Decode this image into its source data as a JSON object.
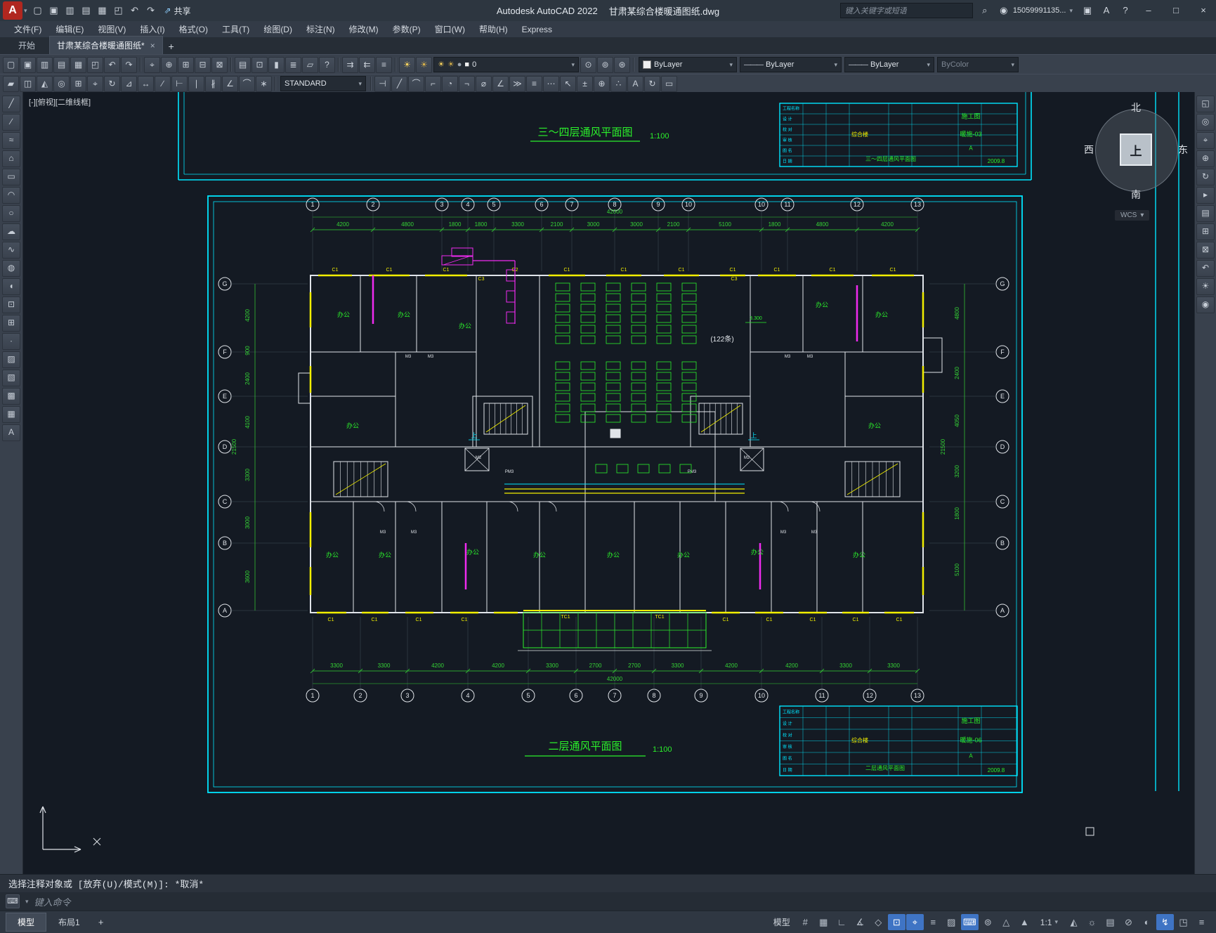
{
  "titlebar": {
    "logo_letter": "A",
    "qat_icons": [
      {
        "name": "new-file-icon",
        "glyph": "▢"
      },
      {
        "name": "open-file-icon",
        "glyph": "▣"
      },
      {
        "name": "save-icon",
        "glyph": "▥"
      },
      {
        "name": "save-as-icon",
        "glyph": "▤"
      },
      {
        "name": "plot-icon",
        "glyph": "▦"
      },
      {
        "name": "plot-preview-icon",
        "glyph": "◰"
      },
      {
        "name": "undo-icon",
        "glyph": "↶"
      },
      {
        "name": "redo-icon",
        "glyph": "↷"
      }
    ],
    "share_icon_glyph": "⇗",
    "share_label": "共享",
    "app_title": "Autodesk AutoCAD 2022",
    "doc_title": "甘肃某综合楼暖通图纸.dwg",
    "search_placeholder": "键入关键字或短语",
    "search_icon_glyph": "⌕",
    "account_id": "15059991135...",
    "cart_icon_glyph": "▣",
    "apps_icon_glyph": "A",
    "help_icon_glyph": "?",
    "minimize_glyph": "–",
    "maximize_glyph": "□",
    "close_glyph": "×",
    "caret_glyph": "▾"
  },
  "menubar": {
    "items": [
      "文件(F)",
      "编辑(E)",
      "视图(V)",
      "插入(I)",
      "格式(O)",
      "工具(T)",
      "绘图(D)",
      "标注(N)",
      "修改(M)",
      "参数(P)",
      "窗口(W)",
      "帮助(H)",
      "Express"
    ]
  },
  "filetabs": {
    "start_label": "开始",
    "doc_label": "甘肃某综合楼暖通图纸*",
    "close_glyph": "×",
    "new_tab_glyph": "+"
  },
  "toolbar1": {
    "file_icons": [
      {
        "name": "new-file-icon",
        "glyph": "▢"
      },
      {
        "name": "open-file-icon",
        "glyph": "▣"
      },
      {
        "name": "save-icon",
        "glyph": "▥"
      },
      {
        "name": "save-as-icon",
        "glyph": "▤"
      },
      {
        "name": "plot-icon",
        "glyph": "▦"
      },
      {
        "name": "plot-preview-icon",
        "glyph": "◰"
      },
      {
        "name": "undo-icon",
        "glyph": "↶"
      },
      {
        "name": "redo-icon",
        "glyph": "↷"
      }
    ],
    "view_icons": [
      {
        "name": "pan-icon",
        "glyph": "⌖"
      },
      {
        "name": "zoom-realtime-icon",
        "glyph": "⊕"
      },
      {
        "name": "zoom-window-icon",
        "glyph": "⊞"
      },
      {
        "name": "zoom-previous-icon",
        "glyph": "⊟"
      },
      {
        "name": "zoom-extents-icon",
        "glyph": "⊠"
      }
    ],
    "palette_icons": [
      {
        "name": "properties-palette-icon",
        "glyph": "▤"
      },
      {
        "name": "design-center-icon",
        "glyph": "⊡"
      },
      {
        "name": "tool-palettes-icon",
        "glyph": "▮"
      },
      {
        "name": "sheet-set-manager-icon",
        "glyph": "≣"
      },
      {
        "name": "markup-import-icon",
        "glyph": "▱"
      },
      {
        "name": "help-icon",
        "glyph": "?"
      }
    ],
    "layer_tool_icons": [
      {
        "name": "match-properties-icon",
        "glyph": "⇉"
      },
      {
        "name": "layer-previous-icon",
        "glyph": "⇇"
      },
      {
        "name": "layer-properties-icon",
        "glyph": "≡"
      }
    ],
    "layer_bulb_icons": [
      {
        "name": "layer-on-icon",
        "glyph": "☀",
        "color": "#ffd75e"
      },
      {
        "name": "layer-freeze-icon",
        "glyph": "☀",
        "color": "#d8b14a"
      }
    ],
    "layer_combo": {
      "bulb_glyph": "☀",
      "freeze_glyph": "☀",
      "lock_glyph": "●",
      "swatch_glyph": "■",
      "value": "0"
    },
    "post_layer_icons": [
      {
        "name": "make-object-layer-current-icon",
        "glyph": "⊙"
      },
      {
        "name": "layer-walk-icon",
        "glyph": "⊚"
      },
      {
        "name": "layer-isolate-icon",
        "glyph": "⊛"
      }
    ],
    "color_combo": {
      "value": "ByLayer"
    },
    "linetype_combo": {
      "sample": "———",
      "value": "ByLayer"
    },
    "lineweight_combo": {
      "sample": "———",
      "value": "ByLayer"
    },
    "plotstyle_combo": {
      "value": "ByColor"
    },
    "caret_glyph": "▾"
  },
  "toolbar2": {
    "modify_icons": [
      {
        "name": "erase-icon",
        "glyph": "▰"
      },
      {
        "name": "copy-icon",
        "glyph": "◫"
      },
      {
        "name": "mirror-icon",
        "glyph": "◭"
      },
      {
        "name": "offset-icon",
        "glyph": "◎"
      },
      {
        "name": "array-icon",
        "glyph": "⊞"
      },
      {
        "name": "move-icon",
        "glyph": "⌖"
      },
      {
        "name": "rotate-icon",
        "glyph": "↻"
      },
      {
        "name": "scale-icon",
        "glyph": "⊿"
      },
      {
        "name": "stretch-icon",
        "glyph": "↔"
      },
      {
        "name": "trim-icon",
        "glyph": "∕"
      },
      {
        "name": "extend-icon",
        "glyph": "⊢"
      },
      {
        "name": "break-at-point-icon",
        "glyph": "∣"
      },
      {
        "name": "break-icon",
        "glyph": "∦"
      },
      {
        "name": "chamfer-icon",
        "glyph": "∠"
      },
      {
        "name": "fillet-icon",
        "glyph": "⌒"
      },
      {
        "name": "explode-icon",
        "glyph": "∗"
      }
    ],
    "style_combo": {
      "value": "STANDARD"
    },
    "dim_icons": [
      {
        "name": "linear-dim-icon",
        "glyph": "⊣"
      },
      {
        "name": "aligned-dim-icon",
        "glyph": "╱"
      },
      {
        "name": "arc-length-dim-icon",
        "glyph": "⌒"
      },
      {
        "name": "ordinate-dim-icon",
        "glyph": "⌐"
      },
      {
        "name": "radius-dim-icon",
        "glyph": "◔"
      },
      {
        "name": "jogged-dim-icon",
        "glyph": "¬"
      },
      {
        "name": "diameter-dim-icon",
        "glyph": "⌀"
      },
      {
        "name": "angular-dim-icon",
        "glyph": "∠"
      },
      {
        "name": "quick-dim-icon",
        "glyph": "≫"
      },
      {
        "name": "baseline-dim-icon",
        "glyph": "≡"
      },
      {
        "name": "continue-dim-icon",
        "glyph": "⋯"
      },
      {
        "name": "leader-icon",
        "glyph": "↖"
      },
      {
        "name": "tolerance-icon",
        "glyph": "±"
      },
      {
        "name": "center-mark-icon",
        "glyph": "⊕"
      },
      {
        "name": "dim-edit-icon",
        "glyph": "∴"
      },
      {
        "name": "dim-text-edit-icon",
        "glyph": "A"
      },
      {
        "name": "dim-update-icon",
        "glyph": "↻"
      },
      {
        "name": "dim-style-icon",
        "glyph": "▭"
      }
    ],
    "caret_glyph": "▾"
  },
  "left_palette": {
    "icons": [
      {
        "name": "line-tool-icon",
        "glyph": "╱"
      },
      {
        "name": "construction-line-tool-icon",
        "glyph": "∕"
      },
      {
        "name": "polyline-tool-icon",
        "glyph": "≈"
      },
      {
        "name": "polygon-tool-icon",
        "glyph": "⌂"
      },
      {
        "name": "rectangle-tool-icon",
        "glyph": "▭"
      },
      {
        "name": "arc-tool-icon",
        "glyph": "◠"
      },
      {
        "name": "circle-tool-icon",
        "glyph": "○"
      },
      {
        "name": "revision-cloud-tool-icon",
        "glyph": "☁"
      },
      {
        "name": "spline-tool-icon",
        "glyph": "∿"
      },
      {
        "name": "ellipse-tool-icon",
        "glyph": "◍"
      },
      {
        "name": "ellipse-arc-tool-icon",
        "glyph": "◖"
      },
      {
        "name": "insert-block-icon",
        "glyph": "⊡"
      },
      {
        "name": "make-block-icon",
        "glyph": "⊞"
      },
      {
        "name": "point-tool-icon",
        "glyph": "∙"
      },
      {
        "name": "hatch-tool-icon",
        "glyph": "▨"
      },
      {
        "name": "gradient-tool-icon",
        "glyph": "▧"
      },
      {
        "name": "region-tool-icon",
        "glyph": "▩"
      },
      {
        "name": "table-tool-icon",
        "glyph": "▦"
      },
      {
        "name": "mtext-tool-icon",
        "glyph": "A"
      }
    ]
  },
  "right_palette": {
    "icons": [
      {
        "name": "fullscreen-icon",
        "glyph": "◱"
      },
      {
        "name": "navigation-wheel-icon",
        "glyph": "◎"
      },
      {
        "name": "pan-tool-icon",
        "glyph": "⌖"
      },
      {
        "name": "zoom-tool-icon",
        "glyph": "⊕"
      },
      {
        "name": "orbit-tool-icon",
        "glyph": "↻"
      },
      {
        "name": "show-motion-icon",
        "glyph": "▸"
      },
      {
        "name": "named-views-icon",
        "glyph": "▤"
      },
      {
        "name": "zoom-window-tool-icon",
        "glyph": "⊞"
      },
      {
        "name": "zoom-extents-tool-icon",
        "glyph": "⊠"
      },
      {
        "name": "previous-view-icon",
        "glyph": "↶"
      },
      {
        "name": "sun-properties-icon",
        "glyph": "☀"
      },
      {
        "name": "render-icon",
        "glyph": "◉"
      }
    ]
  },
  "canvas": {
    "viewport_label": "[-][俯视][二维线框]",
    "compass": {
      "north": "北",
      "south": "南",
      "west": "西",
      "east": "东",
      "center": "上",
      "wcs": "WCS",
      "caret": "▾"
    },
    "drawing": {
      "sheet_top": {
        "title": "三～四层通风平面图",
        "scale": "1:100",
        "drawing_no": "暖施-03"
      },
      "sheet_bottom": {
        "title": "二层通风平面图",
        "scale": "1:100",
        "drawing_no": "暖施-06"
      },
      "axes_top": {
        "bubbles": [
          "1",
          "2",
          "3",
          "4",
          "5",
          "6",
          "7",
          "8",
          "9",
          "10",
          "10",
          "11",
          "12",
          "13"
        ],
        "dims": [
          "4200",
          "4800",
          "1800",
          "1800",
          "3300",
          "2100",
          "3000",
          "3000",
          "2100",
          "5100",
          "1800",
          "4800",
          "4200"
        ],
        "total": "42000"
      },
      "axes_bottom": {
        "bubbles": [
          "1",
          "2",
          "3",
          "4",
          "5",
          "6",
          "7",
          "8",
          "9",
          "10",
          "11",
          "12",
          "13"
        ],
        "dims": [
          "3300",
          "3300",
          "4200",
          "4200",
          "3300",
          "2700",
          "2700",
          "3300",
          "4200",
          "4200",
          "3300",
          "3300"
        ],
        "total": "42000"
      },
      "axes_left": {
        "bubbles": [
          "G",
          "F",
          "E",
          "D",
          "C",
          "B",
          "A"
        ],
        "dims": [
          "4200",
          "900",
          "2400",
          "4100",
          "3300",
          "3000",
          "3600"
        ],
        "total": "21500"
      },
      "axes_right": {
        "bubbles": [
          "G",
          "F",
          "E",
          "D",
          "C",
          "B",
          "A"
        ],
        "dims": [
          "4800",
          "2400",
          "4050",
          "3200",
          "1800",
          "5100"
        ],
        "total": "21500"
      },
      "labels": {
        "room": "办公",
        "note": "(122条)",
        "up": "上",
        "elevation": "3.300",
        "window1": "C1",
        "window2": "C2",
        "window3": "C3",
        "door_m2": "M2",
        "door_m3": "M3",
        "door_pm": "PM3",
        "entrance": "TC1"
      },
      "title_block": {
        "row_labels": [
          "工程名称",
          "设 计",
          "校 对",
          "审 核",
          "图 名",
          "日 期"
        ],
        "type_label": "施工图",
        "project": "综合楼",
        "revision": "A",
        "date": "2009.8"
      }
    }
  },
  "command": {
    "history": "选择注释对象或 [放弃(U)/模式(M)]: *取消*",
    "input_placeholder": "键入命令",
    "icon_glyph": "⌨",
    "caret": "▾"
  },
  "statusbar": {
    "tabs": [
      {
        "label": "模型",
        "active": true
      },
      {
        "label": "布局1",
        "active": false
      }
    ],
    "new_tab_glyph": "+",
    "model_label": "模型",
    "icons1": [
      {
        "name": "grid-icon",
        "glyph": "#"
      },
      {
        "name": "snap-icon",
        "glyph": "▦"
      },
      {
        "name": "ortho-icon",
        "glyph": "∟"
      },
      {
        "name": "polar-tracking-icon",
        "glyph": "∡"
      },
      {
        "name": "isodraft-icon",
        "glyph": "◇"
      },
      {
        "name": "osnap-icon",
        "glyph": "⊡",
        "active": true
      },
      {
        "name": "otrack-icon",
        "glyph": "⌖",
        "active": true
      },
      {
        "name": "lineweight-display-icon",
        "glyph": "≡"
      },
      {
        "name": "transparency-icon",
        "glyph": "▨"
      },
      {
        "name": "dynamic-input-icon",
        "glyph": "⌨",
        "active": true
      },
      {
        "name": "selection-cycling-icon",
        "glyph": "⊚"
      },
      {
        "name": "annotation-visibility-icon",
        "glyph": "△"
      },
      {
        "name": "annotation-autoscale-icon",
        "glyph": "▲"
      }
    ],
    "scale_label": "1:1",
    "caret_glyph": "▾",
    "icons2": [
      {
        "name": "annotation-monitor-icon",
        "glyph": "◭"
      },
      {
        "name": "workspace-switching-icon",
        "glyph": "☼"
      },
      {
        "name": "quick-properties-icon",
        "glyph": "▤"
      },
      {
        "name": "lock-ui-icon",
        "glyph": "⊘"
      },
      {
        "name": "isolate-objects-icon",
        "glyph": "◐"
      },
      {
        "name": "graphics-performance-icon",
        "glyph": "↯",
        "active": true
      },
      {
        "name": "clean-screen-icon",
        "glyph": "◳"
      },
      {
        "name": "customization-icon",
        "glyph": "≡"
      }
    ]
  }
}
